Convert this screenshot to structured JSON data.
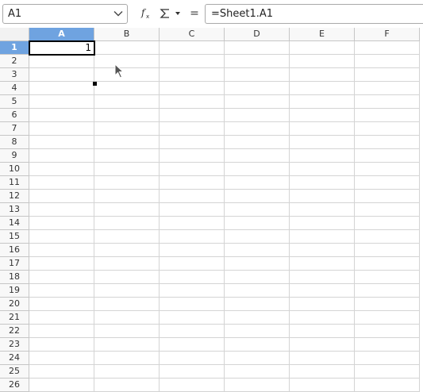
{
  "formula_bar": {
    "name_box_value": "A1",
    "function_wizard_icon": "fx-icon",
    "sum_icon": "sigma-icon",
    "equals_label": "=",
    "formula_value": "=Sheet1.A1"
  },
  "sheet": {
    "columns": [
      "A",
      "B",
      "C",
      "D",
      "E",
      "F"
    ],
    "rows": [
      "1",
      "2",
      "3",
      "4",
      "5",
      "6",
      "7",
      "8",
      "9",
      "10",
      "11",
      "12",
      "13",
      "14",
      "15",
      "16",
      "17",
      "18",
      "19",
      "20",
      "21",
      "22",
      "23",
      "24",
      "25",
      "26"
    ],
    "selected_column": "A",
    "selected_row": "1",
    "active_cell": "A1",
    "cell_values": {
      "A1": "1"
    }
  },
  "colors": {
    "header_selected": "#6fa3e0",
    "grid_line": "#d4d4d4"
  }
}
